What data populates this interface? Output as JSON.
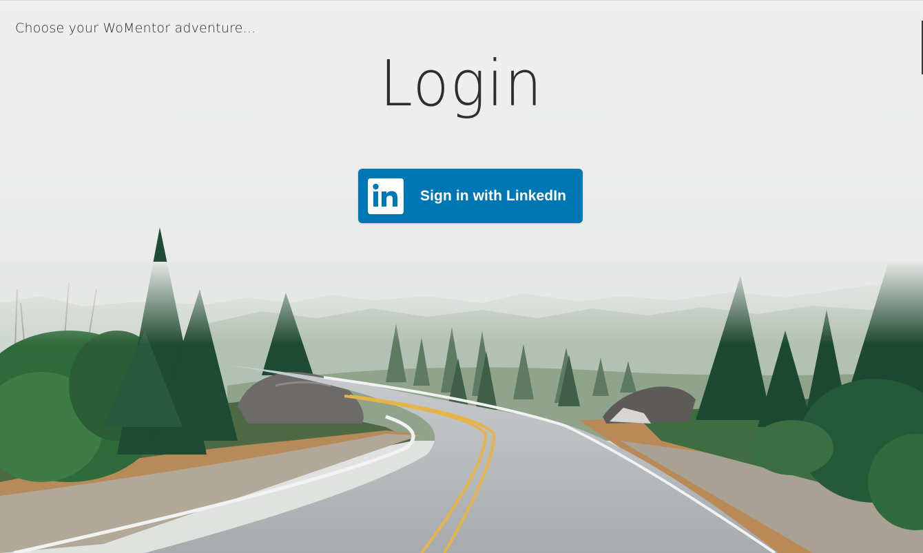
{
  "header": {
    "tagline": "Choose your WoMentor adventure..."
  },
  "main": {
    "title": "Login",
    "linkedin_button": {
      "label": "Sign in with LinkedIn",
      "icon": "linkedin-icon"
    }
  },
  "background": {
    "scene": "foggy forest road"
  },
  "colors": {
    "linkedin_blue": "#0077b5",
    "text_dark": "#2e2e2e",
    "sky": "#ececec"
  }
}
